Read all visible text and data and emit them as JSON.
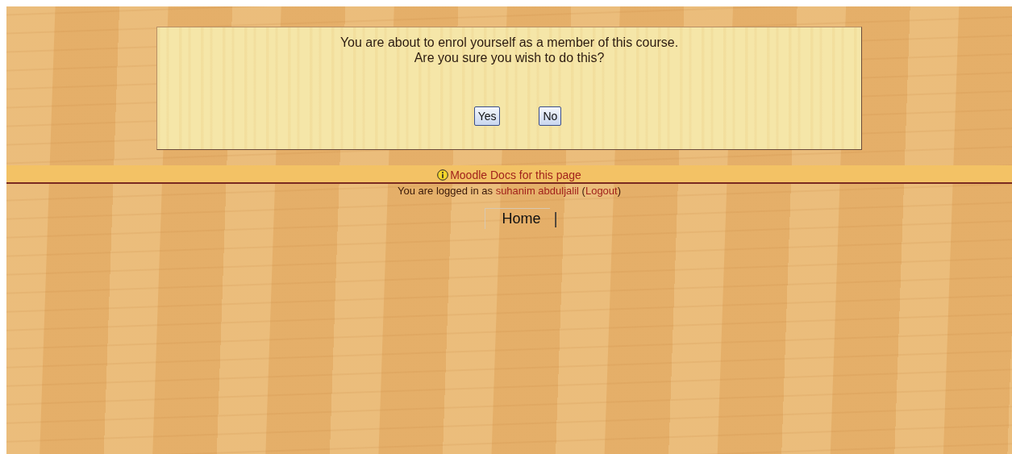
{
  "confirm": {
    "message_lines": [
      "You are about to enrol yourself as a member of this course.",
      "Are you sure you wish to do this?"
    ],
    "buttons": [
      {
        "label": "Yes"
      },
      {
        "label": "No"
      }
    ]
  },
  "footer": {
    "docs_link": "Moodle Docs for this page",
    "login": {
      "prefix": "You are logged in as ",
      "user": "suhanim abduljalil",
      "open": " (",
      "logout": "Logout",
      "close": ")"
    },
    "home_link": "Home",
    "separator": "|"
  }
}
